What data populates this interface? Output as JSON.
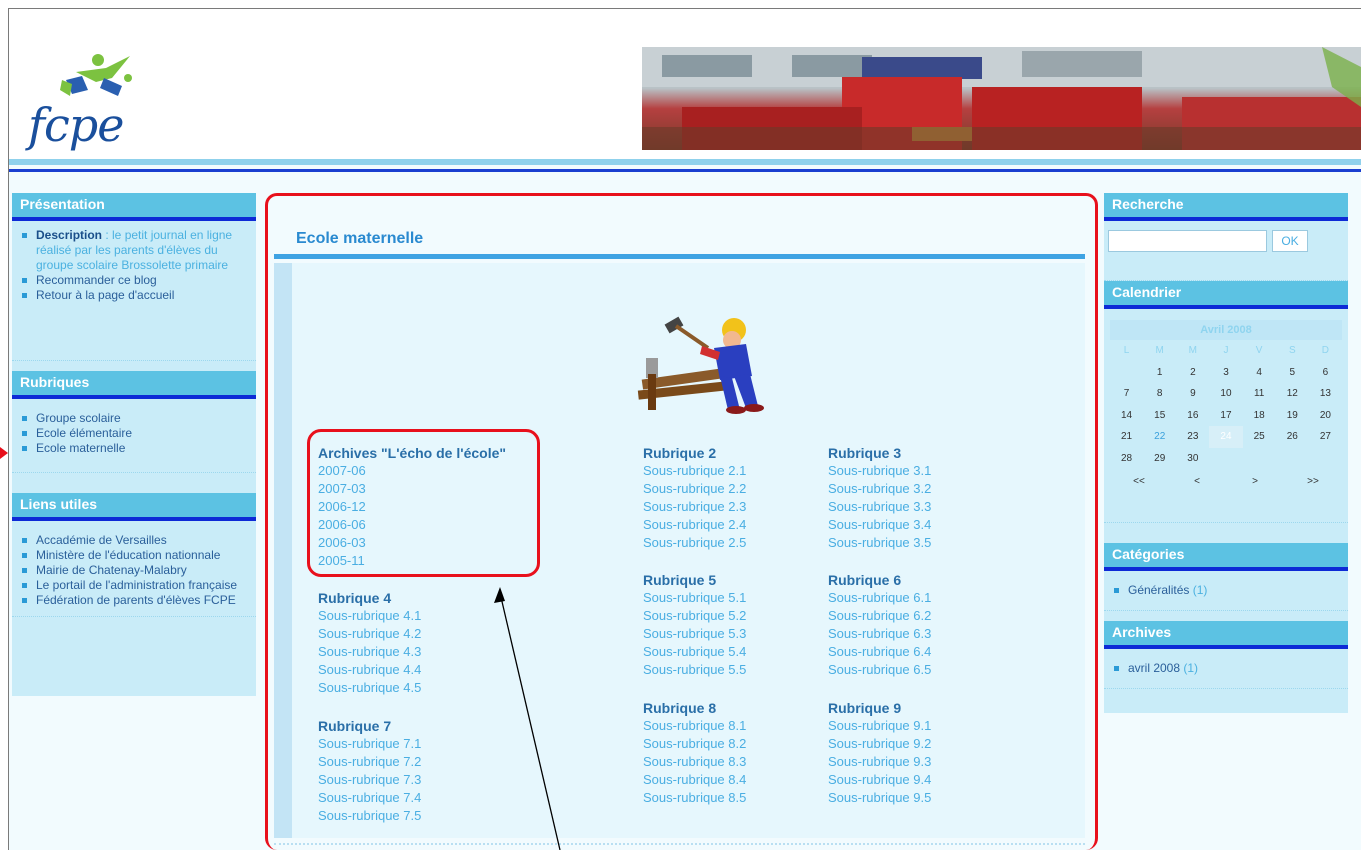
{
  "logo": {
    "text": "fcpe"
  },
  "left_sidebar": {
    "presentation": {
      "title": "Présentation",
      "description_label": "Description",
      "description_text": " : le petit journal en ligne réalisé par les parents d'élèves du groupe scolaire Brossolette primaire",
      "items": [
        "Recommander ce blog",
        "Retour à la page d'accueil"
      ]
    },
    "rubriques": {
      "title": "Rubriques",
      "items": [
        "Groupe scolaire",
        "Ecole élémentaire",
        "Ecole maternelle"
      ]
    },
    "liens": {
      "title": "Liens utiles",
      "items": [
        "Accadémie de Versailles",
        "Ministère de l'éducation nationnale",
        "Mairie de Chatenay-Malabry",
        "Le portail de l'administration française",
        "Fédération de parents d'élèves FCPE"
      ]
    }
  },
  "main": {
    "title": "Ecole maternelle",
    "columns": [
      {
        "heading": "Archives \"L'écho de l'école\"",
        "items": [
          "2007-06",
          "2007-03",
          "2006-12",
          "2006-06",
          "2006-03",
          "2005-11"
        ]
      },
      {
        "heading": "Rubrique 2",
        "items": [
          "Sous-rubrique 2.1",
          "Sous-rubrique 2.2",
          "Sous-rubrique 2.3",
          "Sous-rubrique 2.4",
          "Sous-rubrique 2.5"
        ]
      },
      {
        "heading": "Rubrique 3",
        "items": [
          "Sous-rubrique 3.1",
          "Sous-rubrique 3.2",
          "Sous-rubrique 3.3",
          "Sous-rubrique 3.4",
          "Sous-rubrique 3.5"
        ]
      },
      {
        "heading": "Rubrique 4",
        "items": [
          "Sous-rubrique 4.1",
          "Sous-rubrique 4.2",
          "Sous-rubrique 4.3",
          "Sous-rubrique 4.4",
          "Sous-rubrique 4.5"
        ]
      },
      {
        "heading": "Rubrique 5",
        "items": [
          "Sous-rubrique 5.1",
          "Sous-rubrique 5.2",
          "Sous-rubrique 5.3",
          "Sous-rubrique 5.4",
          "Sous-rubrique 5.5"
        ]
      },
      {
        "heading": "Rubrique 6",
        "items": [
          "Sous-rubrique 6.1",
          "Sous-rubrique 6.2",
          "Sous-rubrique 6.3",
          "Sous-rubrique 6.4",
          "Sous-rubrique 6.5"
        ]
      },
      {
        "heading": "Rubrique 7",
        "items": [
          "Sous-rubrique 7.1",
          "Sous-rubrique 7.2",
          "Sous-rubrique 7.3",
          "Sous-rubrique 7.4",
          "Sous-rubrique 7.5"
        ]
      },
      {
        "heading": "Rubrique 8",
        "items": [
          "Sous-rubrique 8.1",
          "Sous-rubrique 8.2",
          "Sous-rubrique 8.3",
          "Sous-rubrique 8.4",
          "Sous-rubrique 8.5"
        ]
      },
      {
        "heading": "Rubrique 9",
        "items": [
          "Sous-rubrique 9.1",
          "Sous-rubrique 9.2",
          "Sous-rubrique 9.3",
          "Sous-rubrique 9.4",
          "Sous-rubrique 9.5"
        ]
      }
    ]
  },
  "right_sidebar": {
    "recherche": {
      "title": "Recherche",
      "button": "OK",
      "value": ""
    },
    "calendrier": {
      "title": "Calendrier",
      "month": "Avril 2008",
      "days": [
        "L",
        "M",
        "M",
        "J",
        "V",
        "S",
        "D"
      ],
      "weeks": [
        [
          "",
          "1",
          "2",
          "3",
          "4",
          "5",
          "6"
        ],
        [
          "7",
          "8",
          "9",
          "10",
          "11",
          "12",
          "13"
        ],
        [
          "14",
          "15",
          "16",
          "17",
          "18",
          "19",
          "20"
        ],
        [
          "21",
          "22",
          "23",
          "24",
          "25",
          "26",
          "27"
        ],
        [
          "28",
          "29",
          "30",
          "",
          "",
          "",
          ""
        ]
      ],
      "linked_day": "22",
      "today": "24",
      "nav": [
        "<<",
        "<",
        ">",
        ">>"
      ]
    },
    "categories": {
      "title": "Catégories",
      "items": [
        {
          "label": "Généralités",
          "count": "(1)"
        }
      ]
    },
    "archives": {
      "title": "Archives",
      "items": [
        {
          "label": "avril 2008",
          "count": "(1)"
        }
      ]
    }
  },
  "colors": {
    "accent": "#5cc2e3",
    "dark_rule": "#0d2ad6",
    "annotation": "#e8101c",
    "link": "#4aaee2"
  }
}
